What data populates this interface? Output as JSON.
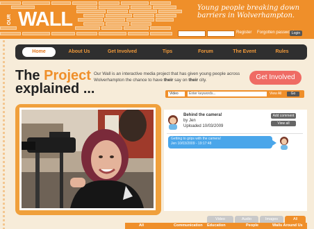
{
  "header": {
    "logo_small": "OUR",
    "logo_big": "WALL",
    "tagline_line1": "Young people breaking down",
    "tagline_line2": "barriers in Wolverhampton.",
    "register": "Register",
    "forgotten": "Forgotten password",
    "login": "Login"
  },
  "nav": {
    "items": [
      "Home",
      "About Us",
      "Get Involved",
      "Tips",
      "Forum",
      "The Event",
      "Rules"
    ]
  },
  "page": {
    "title_the": "The",
    "title_project": "Project",
    "title_line2": "explained ...",
    "intro_pre": "Our Wall is an interactive media project that has given young people across Wolverhampton the chance to have",
    "intro_their": "their",
    "intro_mid": "say on",
    "intro_their2": "their",
    "intro_end": "city.",
    "cta": "Get Involved"
  },
  "search": {
    "type_value": "Video",
    "placeholder": "Enter keywords...",
    "view_all": "View All",
    "go": "Go"
  },
  "post": {
    "title": "Behind the camera!",
    "by": "by Jen",
    "uploaded": "Uploaded 10/03/2009",
    "add_comment": "Add comment",
    "view_all": "View all"
  },
  "comment": {
    "text": "Getting to grips with the camera!",
    "meta": "Jen 10/03/2009 - 19:17:48"
  },
  "tabs": [
    "Video",
    "Audio",
    "Images",
    "All"
  ],
  "categories": [
    "All",
    "Communication",
    "Education",
    "People",
    "Walls Around Us"
  ],
  "colors": {
    "brand_orange": "#ef8f2a",
    "nav_dark": "#2f2f2f",
    "cta_red": "#ef6b64",
    "bubble_blue": "#4aa6ea"
  }
}
